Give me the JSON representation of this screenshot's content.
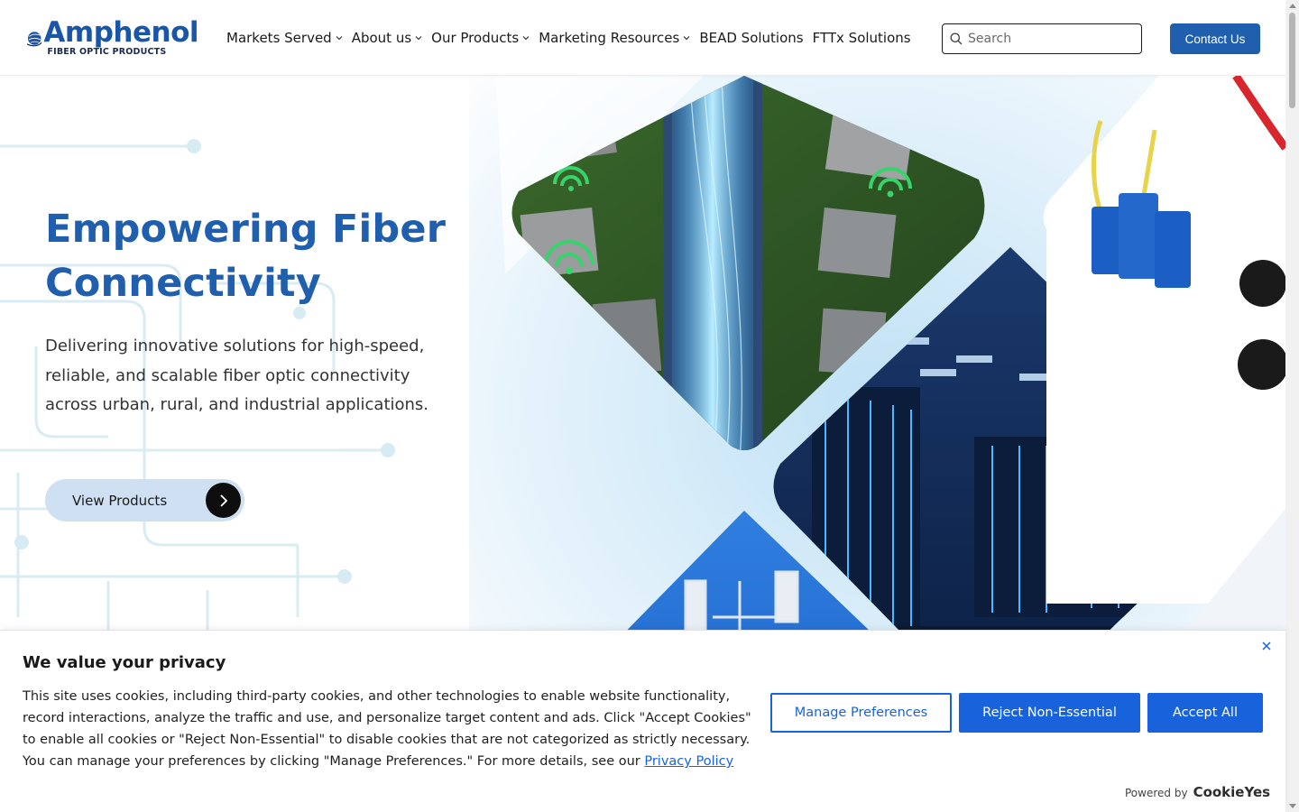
{
  "header": {
    "logo": {
      "word": "Amphenol",
      "subtitle": "FIBER OPTIC PRODUCTS"
    },
    "nav": [
      {
        "label": "Markets Served",
        "has_dropdown": true
      },
      {
        "label": "About us",
        "has_dropdown": true
      },
      {
        "label": "Our Products",
        "has_dropdown": true
      },
      {
        "label": "Marketing Resources",
        "has_dropdown": true
      },
      {
        "label": "BEAD Solutions",
        "has_dropdown": false
      },
      {
        "label": "FTTx Solutions",
        "has_dropdown": false
      }
    ],
    "search": {
      "placeholder": "Search",
      "value": ""
    },
    "contact_label": "Contact Us"
  },
  "hero": {
    "title": "Empowering Fiber Connectivity",
    "description": "Delivering innovative solutions for high-speed, reliable, and scalable fiber optic connectivity across urban, rural, and industrial applications.",
    "cta_label": "View Products"
  },
  "cookie_banner": {
    "title": "We value your privacy",
    "body": "This site uses cookies, including third-party cookies, and other technologies to enable website functionality, record interactions, analyze the traffic and use, and personalize target content and ads. Click \"Accept Cookies\" to enable all cookies or \"Reject Non-Essential\" to disable cookies that are not categorized as strictly necessary. You can manage your preferences by clicking \"Manage Preferences.\" For more details, see our",
    "link_label": "Privacy Policy",
    "manage_label": "Manage Preferences",
    "reject_label": "Reject Non-Essential",
    "accept_label": "Accept All",
    "powered_by": "Powered by",
    "powered_brand": "CookieYes"
  },
  "colors": {
    "brand_blue": "#1f5fae",
    "cookie_blue": "#1863dc",
    "cta_bg": "#cfe0f3"
  },
  "icons": [
    "globe-logo-icon",
    "chevron-down-icon",
    "search-icon",
    "arrow-right-icon",
    "close-icon"
  ]
}
